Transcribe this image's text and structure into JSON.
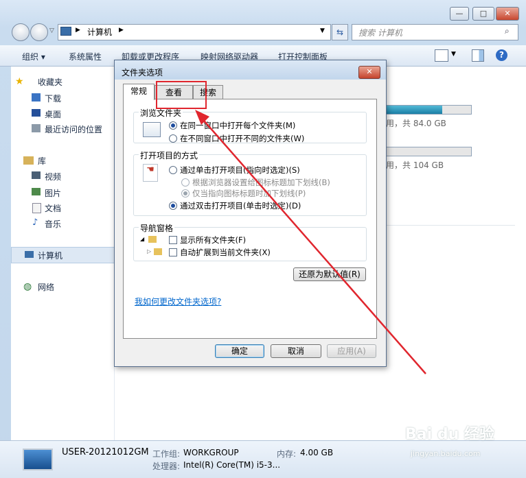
{
  "window": {
    "controls": {
      "minimize": "—",
      "maximize": "□",
      "close": "✕"
    }
  },
  "address": {
    "path": "计算机",
    "search_placeholder": "搜索 计算机"
  },
  "toolbar": {
    "items": [
      "组织 ▾",
      "系统属性",
      "卸载或更改程序",
      "映射网络驱动器",
      "打开控制面板"
    ]
  },
  "sidebar": {
    "favorites": "收藏夹",
    "fav_items": [
      "下载",
      "桌面",
      "最近访问的位置"
    ],
    "libraries": "库",
    "lib_items": [
      "视频",
      "图片",
      "文档",
      "音乐"
    ],
    "computer": "计算机",
    "network": "网络"
  },
  "drives": [
    {
      "free_text": "用，共 84.0 GB",
      "fill": 0.6
    },
    {
      "free_text": "用，共 104 GB",
      "fill": 0.0
    }
  ],
  "details": {
    "name": "USER-20121012GM",
    "workgroup_label": "工作组:",
    "workgroup": "WORKGROUP",
    "memory_label": "内存:",
    "memory": "4.00 GB",
    "cpu_label": "处理器:",
    "cpu": "Intel(R) Core(TM) i5-3..."
  },
  "dialog": {
    "title": "文件夹选项",
    "close": "✕",
    "tabs": [
      "常规",
      "查看",
      "搜索"
    ],
    "browse_group": "浏览文件夹",
    "browse_opt1": "在同一窗口中打开每个文件夹(M)",
    "browse_opt2": "在不同窗口中打开不同的文件夹(W)",
    "click_group": "打开项目的方式",
    "click_opt1": "通过单击打开项目(指向时选定)(S)",
    "click_sub1": "根据浏览器设置给图标标题加下划线(B)",
    "click_sub2": "仅当指向图标标题时加下划线(P)",
    "click_opt2": "通过双击打开项目(单击时选定)(D)",
    "nav_group": "导航窗格",
    "nav_opt1": "显示所有文件夹(F)",
    "nav_opt2": "自动扩展到当前文件夹(X)",
    "restore": "还原为默认值(R)",
    "help_link": "我如何更改文件夹选项?",
    "ok": "确定",
    "cancel": "取消",
    "apply": "应用(A)"
  },
  "watermark": {
    "brand": "Bai du 经验",
    "url": "jingyan.baidu.com"
  },
  "annotation_color": "#e0262e"
}
